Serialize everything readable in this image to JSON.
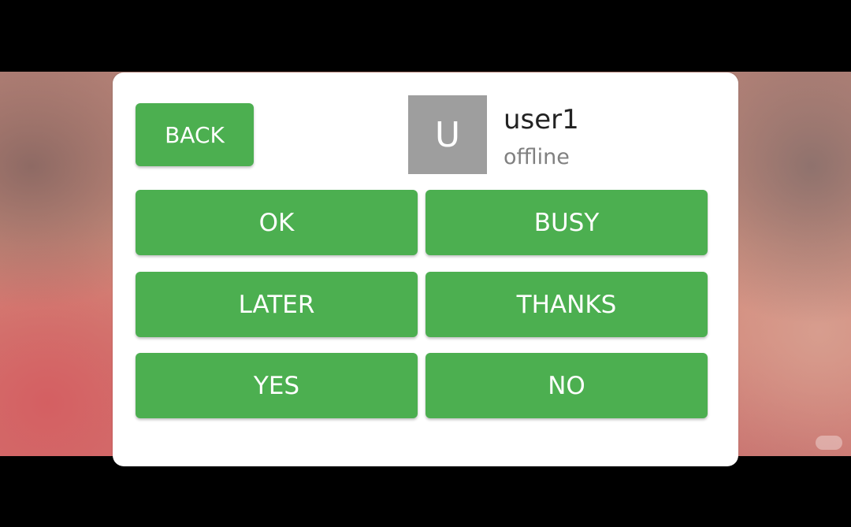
{
  "dialog": {
    "back_label": "BACK",
    "contact": {
      "avatar_letter": "U",
      "name": "user1",
      "status": "offline"
    },
    "quick_replies": [
      "OK",
      "BUSY",
      "LATER",
      "THANKS",
      "YES",
      "NO"
    ]
  },
  "colors": {
    "button": "#4caf50",
    "avatar_bg": "#9e9e9e",
    "dialog_bg": "#ffffff"
  }
}
